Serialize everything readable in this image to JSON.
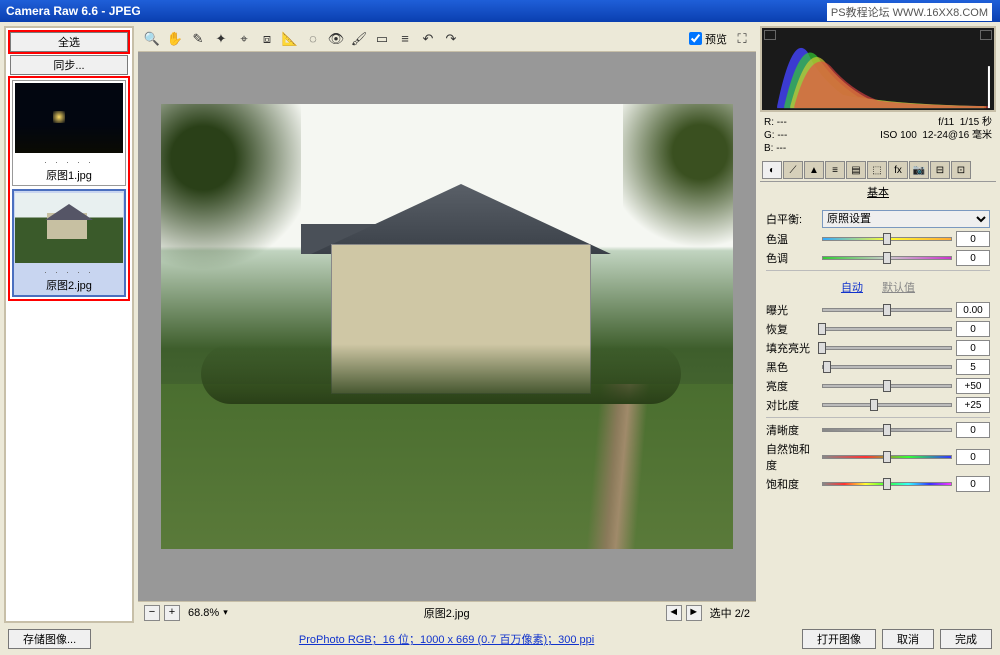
{
  "titlebar": {
    "title": "Camera Raw 6.6 - JPEG"
  },
  "watermark": "PS教程论坛 WWW.16XX8.COM",
  "filmstrip": {
    "select_all": "全选",
    "sync": "同步...",
    "thumbs": [
      {
        "label": "原图1.jpg"
      },
      {
        "label": "原图2.jpg"
      }
    ]
  },
  "preview": {
    "checkbox_label": "预览"
  },
  "zoombar": {
    "minus": "−",
    "plus": "+",
    "zoom": "68.8%",
    "filename": "原图2.jpg",
    "selection": "选中 2/2"
  },
  "meta": {
    "r": "R: ---",
    "g": "G: ---",
    "b": "B: ---",
    "aperture": "f/11",
    "shutter": "1/15 秒",
    "iso": "ISO 100",
    "lens": "12-24@16 毫米"
  },
  "panel": {
    "title": "基本",
    "wb_label": "白平衡:",
    "wb_value": "原照设置",
    "temp": "色温",
    "tint": "色调",
    "auto": "自动",
    "default": "默认值",
    "sliders": {
      "exposure": {
        "label": "曝光",
        "value": "0.00",
        "pos": 50
      },
      "recovery": {
        "label": "恢复",
        "value": "0",
        "pos": 0
      },
      "fill": {
        "label": "填充亮光",
        "value": "0",
        "pos": 0
      },
      "black": {
        "label": "黑色",
        "value": "5",
        "pos": 4
      },
      "bright": {
        "label": "亮度",
        "value": "+50",
        "pos": 50
      },
      "contrast": {
        "label": "对比度",
        "value": "+25",
        "pos": 40
      },
      "clarity": {
        "label": "清晰度",
        "value": "0",
        "pos": 50
      },
      "vibrance": {
        "label": "自然饱和度",
        "value": "0",
        "pos": 50
      },
      "sat": {
        "label": "饱和度",
        "value": "0",
        "pos": 50
      }
    },
    "temp_val": "0",
    "tint_val": "0"
  },
  "footer": {
    "save": "存储图像...",
    "profile": "ProPhoto RGB；16 位；1000 x 669 (0.7 百万像素)；300 ppi",
    "open": "打开图像",
    "cancel": "取消",
    "done": "完成"
  }
}
